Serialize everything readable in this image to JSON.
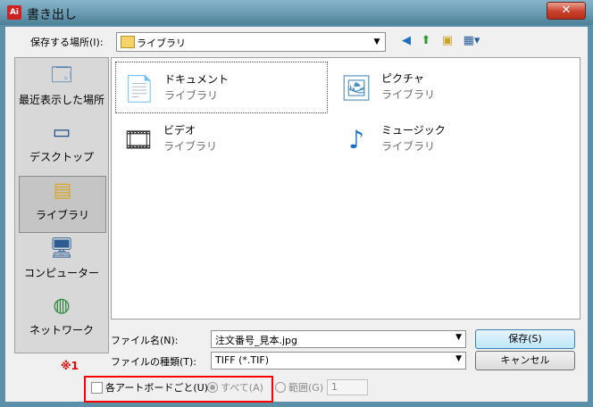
{
  "window": {
    "title": "書き出し",
    "app_icon": "Ai",
    "close": "✕"
  },
  "toolbar": {
    "save_in_label": "保存する場所(I):",
    "location": "ライブラリ",
    "icons": [
      "back-icon",
      "up-folder-icon",
      "new-folder-icon",
      "view-menu-icon"
    ]
  },
  "places": [
    {
      "label": "最近表示した場所",
      "icon": "recent-places-icon"
    },
    {
      "label": "デスクトップ",
      "icon": "desktop-icon"
    },
    {
      "label": "ライブラリ",
      "icon": "libraries-icon",
      "selected": true
    },
    {
      "label": "コンピューター",
      "icon": "computer-icon"
    },
    {
      "label": "ネットワーク",
      "icon": "network-icon"
    }
  ],
  "files": [
    {
      "name": "ドキュメント",
      "type": "ライブラリ",
      "icon": "documents-library-icon"
    },
    {
      "name": "ピクチャ",
      "type": "ライブラリ",
      "icon": "pictures-library-icon"
    },
    {
      "name": "ビデオ",
      "type": "ライブラリ",
      "icon": "videos-library-icon"
    },
    {
      "name": "ミュージック",
      "type": "ライブラリ",
      "icon": "music-library-icon"
    }
  ],
  "form": {
    "filename_label": "ファイル名(N):",
    "filename": "注文番号_見本.jpg",
    "filetype_label": "ファイルの種類(T):",
    "filetype": "TIFF (*.TIF)",
    "save_button": "保存(S)",
    "cancel_button": "キャンセル"
  },
  "options": {
    "note": "※1",
    "each_artboard": "各アートボードごと(U)",
    "all": "すべて(A)",
    "range": "範囲(G)",
    "range_value": "1"
  },
  "colors": {
    "highlight_box": "#ff0000",
    "note": "#ee0000"
  }
}
